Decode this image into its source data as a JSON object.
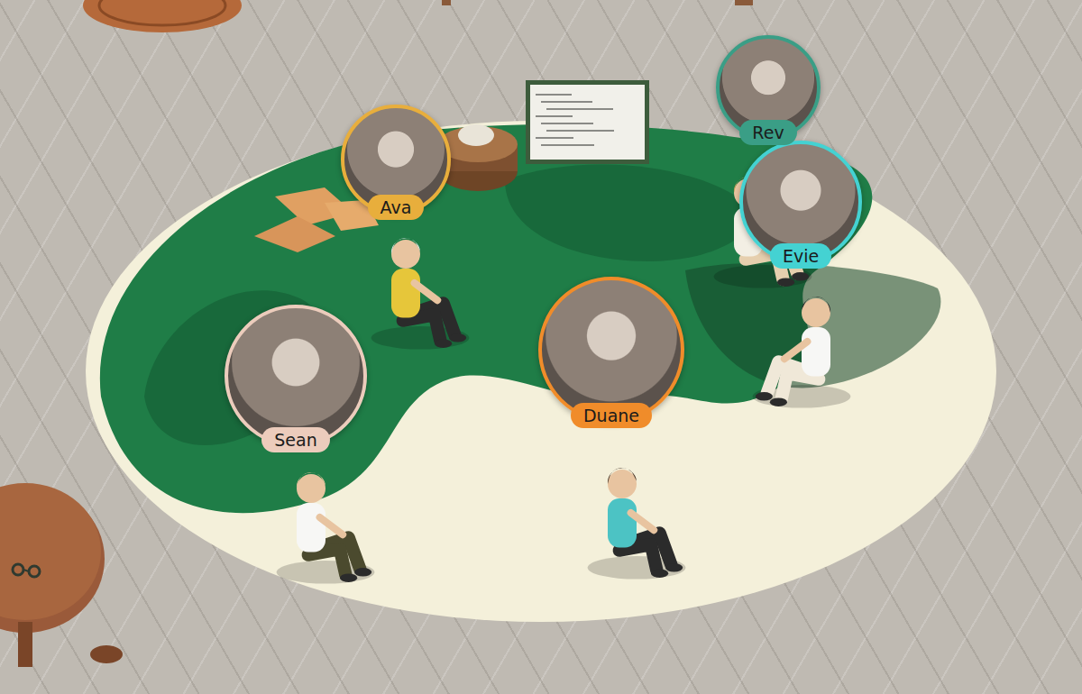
{
  "participants": [
    {
      "name": "Ava",
      "color": "#e8ae3c"
    },
    {
      "name": "Rev",
      "color": "#3a9e86"
    },
    {
      "name": "Evie",
      "color": "#44d2d2"
    },
    {
      "name": "Sean",
      "color": "#ecccbc"
    },
    {
      "name": "Duane",
      "color": "#f08c2a"
    }
  ]
}
